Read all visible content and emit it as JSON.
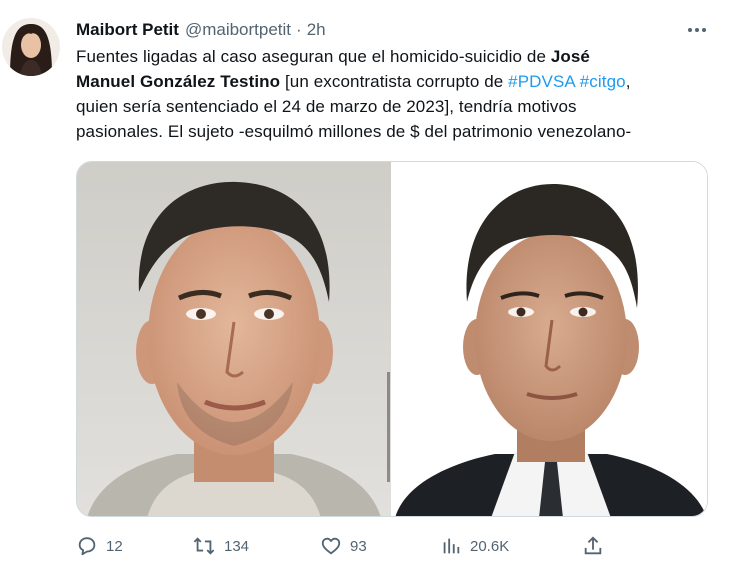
{
  "tweet": {
    "author_name": "Maibort Petit",
    "author_handle": "@maibortpetit",
    "separator": "·",
    "time": "2h",
    "text": {
      "line1_plain": "Fuentes ligadas al caso aseguran que el homicido-suicidio de ",
      "line1_bold": "José",
      "line2_bold": "Manuel González Testino",
      "line2_plain": " [un excontratista corrupto de ",
      "hashtag_pdvsa": "#PDVSA",
      "space": " ",
      "hashtag_citgo": "#citgo",
      "line2_end": ",",
      "line3": "quien sería sentenciado el 24 de marzo de 2023], tendría motivos",
      "line4": "pasionales. El sujeto -esquilmó millones de $ del patrimonio venezolano-"
    },
    "stats": {
      "replies": "12",
      "retweets": "134",
      "likes": "93",
      "views": "20.6K"
    },
    "icons": {
      "more": "more-dots-icon",
      "reply": "reply-icon",
      "retweet": "retweet-icon",
      "like": "heart-icon",
      "views": "views-chart-icon",
      "share": "share-icon"
    },
    "colors": {
      "link": "#1d9bf0",
      "secondary_text": "#536471",
      "primary_text": "#0f1419",
      "border": "#cfd9de"
    }
  }
}
